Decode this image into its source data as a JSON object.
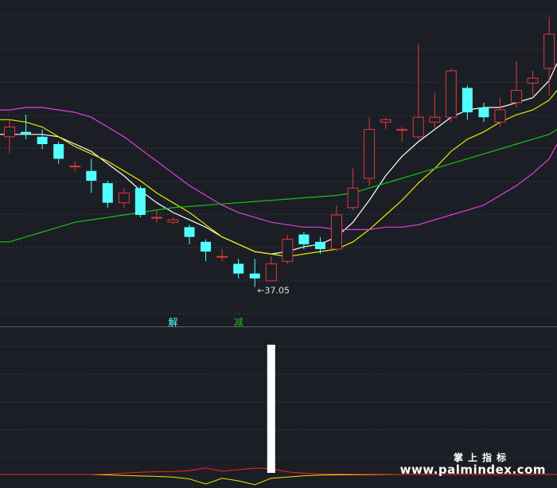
{
  "chart_data": [
    {
      "type": "candlestick",
      "title": "",
      "colors": {
        "up": "#e03a3a",
        "down": "#54ffff",
        "background": "#1b1e24",
        "grid": "#3a4050"
      },
      "candles": [
        {
          "o": 43.2,
          "h": 43.9,
          "l": 42.5,
          "c": 43.6
        },
        {
          "o": 43.4,
          "h": 44.1,
          "l": 43.1,
          "c": 43.3
        },
        {
          "o": 43.2,
          "h": 43.5,
          "l": 42.7,
          "c": 42.9
        },
        {
          "o": 42.9,
          "h": 43.0,
          "l": 42.1,
          "c": 42.3
        },
        {
          "o": 42.0,
          "h": 42.2,
          "l": 41.8,
          "c": 42.0
        },
        {
          "o": 41.8,
          "h": 42.3,
          "l": 40.9,
          "c": 41.4
        },
        {
          "o": 41.3,
          "h": 41.4,
          "l": 40.3,
          "c": 40.5
        },
        {
          "o": 40.5,
          "h": 41.1,
          "l": 40.3,
          "c": 40.9
        },
        {
          "o": 41.1,
          "h": 41.2,
          "l": 39.9,
          "c": 40.0
        },
        {
          "o": 39.9,
          "h": 40.2,
          "l": 39.7,
          "c": 39.9
        },
        {
          "o": 39.7,
          "h": 39.9,
          "l": 39.6,
          "c": 39.8
        },
        {
          "o": 39.5,
          "h": 39.6,
          "l": 38.8,
          "c": 39.1
        },
        {
          "o": 38.9,
          "h": 39.0,
          "l": 38.1,
          "c": 38.5
        },
        {
          "o": 38.3,
          "h": 38.6,
          "l": 38.1,
          "c": 38.3
        },
        {
          "o": 38.0,
          "h": 38.2,
          "l": 37.4,
          "c": 37.6
        },
        {
          "o": 37.6,
          "h": 38.2,
          "l": 37.05,
          "c": 37.4
        },
        {
          "o": 37.3,
          "h": 38.3,
          "l": 37.3,
          "c": 38.0
        },
        {
          "o": 38.1,
          "h": 39.2,
          "l": 38.0,
          "c": 39.0
        },
        {
          "o": 39.2,
          "h": 39.3,
          "l": 38.6,
          "c": 38.8
        },
        {
          "o": 38.9,
          "h": 39.1,
          "l": 38.4,
          "c": 38.6
        },
        {
          "o": 38.6,
          "h": 40.4,
          "l": 38.5,
          "c": 40.0
        },
        {
          "o": 40.3,
          "h": 41.9,
          "l": 40.2,
          "c": 41.1
        },
        {
          "o": 41.5,
          "h": 44.0,
          "l": 41.2,
          "c": 43.5
        },
        {
          "o": 43.8,
          "h": 44.0,
          "l": 43.5,
          "c": 43.9
        },
        {
          "o": 43.5,
          "h": 43.6,
          "l": 43.0,
          "c": 43.5
        },
        {
          "o": 43.2,
          "h": 47.0,
          "l": 43.1,
          "c": 44.0
        },
        {
          "o": 43.8,
          "h": 45.0,
          "l": 43.5,
          "c": 44.0
        },
        {
          "o": 44.0,
          "h": 46.0,
          "l": 43.8,
          "c": 45.9
        },
        {
          "o": 45.2,
          "h": 45.3,
          "l": 43.9,
          "c": 44.2
        },
        {
          "o": 44.4,
          "h": 44.6,
          "l": 43.8,
          "c": 44.0
        },
        {
          "o": 43.8,
          "h": 44.8,
          "l": 43.6,
          "c": 44.3
        },
        {
          "o": 44.6,
          "h": 46.3,
          "l": 44.4,
          "c": 45.1
        },
        {
          "o": 45.4,
          "h": 45.9,
          "l": 44.9,
          "c": 45.6
        },
        {
          "o": 46.0,
          "h": 48.1,
          "l": 44.9,
          "c": 47.4
        }
      ],
      "moving_averages": [
        {
          "color": "#ffffff",
          "values": [
            43.3,
            43.3,
            43.3,
            43.2,
            42.9,
            42.6,
            42.1,
            41.6,
            41.0,
            40.5,
            40.1,
            39.8,
            39.5,
            39.1,
            38.8,
            38.5,
            38.4,
            38.5,
            38.7,
            38.8,
            39.1,
            39.7,
            40.6,
            41.6,
            42.4,
            43.0,
            43.5,
            44.0,
            44.3,
            44.4,
            44.4,
            44.6,
            44.8,
            45.5
          ]
        },
        {
          "color": "#e8e800",
          "values": [
            43.9,
            43.8,
            43.6,
            43.2,
            42.8,
            42.5,
            42.2,
            41.8,
            41.4,
            40.9,
            40.5,
            40.1,
            39.6,
            39.1,
            38.8,
            38.5,
            38.4,
            38.3,
            38.4,
            38.5,
            38.6,
            38.9,
            39.4,
            40.0,
            40.6,
            41.3,
            41.9,
            42.6,
            43.1,
            43.4,
            43.8,
            44.1,
            44.3,
            44.7
          ]
        },
        {
          "color": "#e040e0",
          "values": [
            44.3,
            44.4,
            44.4,
            44.3,
            44.2,
            44.0,
            43.6,
            43.2,
            42.7,
            42.2,
            41.7,
            41.2,
            40.8,
            40.4,
            40.1,
            39.9,
            39.7,
            39.6,
            39.5,
            39.5,
            39.4,
            39.4,
            39.4,
            39.5,
            39.5,
            39.6,
            39.8,
            40.0,
            40.2,
            40.4,
            40.8,
            41.2,
            41.7,
            42.3
          ]
        },
        {
          "color": "#18c018",
          "values": [
            38.9,
            39.1,
            39.3,
            39.5,
            39.7,
            39.8,
            39.9,
            40.0,
            40.1,
            40.2,
            40.3,
            40.35,
            40.4,
            40.45,
            40.5,
            40.55,
            40.6,
            40.65,
            40.7,
            40.75,
            40.8,
            40.9,
            41.1,
            41.3,
            41.5,
            41.7,
            41.9,
            42.1,
            42.3,
            42.5,
            42.7,
            42.9,
            43.1,
            43.3
          ]
        }
      ],
      "ylim": [
        35.6,
        48.8
      ],
      "min_label": "37.05",
      "min_index": 15,
      "signal_labels": [
        {
          "text": "解",
          "index": 10,
          "color": "#54ffff"
        },
        {
          "text": "减",
          "index": 14,
          "color": "#18c018"
        }
      ]
    },
    {
      "type": "bar",
      "ylim": [
        0,
        100
      ],
      "bar": {
        "index": 16,
        "value": 100,
        "color": "#ffffff"
      },
      "red_line": [
        0,
        0,
        0,
        0,
        0,
        0,
        0.3,
        1.0,
        1.8,
        2.1,
        2.3,
        3.0,
        5.2,
        2.5,
        3.8,
        5.0,
        4.5,
        2.0,
        1.0,
        0.5,
        0.4,
        0.3,
        0.2,
        0.1,
        0,
        0,
        0,
        0,
        0,
        0,
        0,
        0,
        0,
        0
      ],
      "yellow_line": [
        0,
        0,
        0,
        0,
        0,
        0,
        -0.3,
        -0.8,
        -1.2,
        -1.5,
        -2.0,
        -3.5,
        -7.5,
        -3.0,
        -5.0,
        -8.0,
        -3.0,
        -2.0,
        -1.0,
        -0.5,
        -0.3,
        -0.2,
        -0.1,
        0,
        0,
        0,
        0,
        0,
        0,
        0,
        0,
        0,
        0,
        0
      ],
      "colors": {
        "red_line": "#ff2020",
        "yellow_line": "#e8e800",
        "baseline": "#e8e800"
      }
    }
  ],
  "watermark": {
    "title": "掌上指标",
    "url": "www.palmindex.com"
  }
}
